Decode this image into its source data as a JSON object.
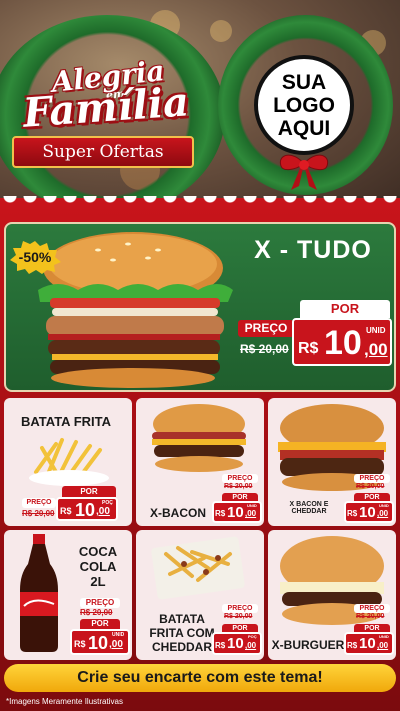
{
  "header": {
    "brand_line1": "Alegria",
    "brand_em": "em",
    "brand_line2": "Família",
    "subtitle": "Super Ofertas",
    "logo_placeholder": [
      "SUA",
      "LOGO",
      "AQUI"
    ]
  },
  "featured": {
    "name": "X - TUDO",
    "discount_badge": "-50%",
    "por_label": "POR",
    "preco_label": "PREÇO",
    "old_price": "R$ 20,00",
    "currency": "R$",
    "price_int": "10",
    "price_cents": ",00",
    "unit": "UNID"
  },
  "products": [
    {
      "name": "BATATA FRITA",
      "preco_label": "PREÇO",
      "old_price": "R$ 20,00",
      "por_label": "POR",
      "currency": "R$",
      "price_int": "10",
      "price_cents": ",00",
      "unit": "POÇ"
    },
    {
      "name": "X-BACON",
      "preco_label": "PREÇO",
      "old_price": "R$ 20,00",
      "por_label": "POR",
      "currency": "R$",
      "price_int": "10",
      "price_cents": ",00",
      "unit": "UNID"
    },
    {
      "name": "X BACON E CHEDDAR",
      "preco_label": "PREÇO",
      "old_price": "R$ 20,00",
      "por_label": "POR",
      "currency": "R$",
      "price_int": "10",
      "price_cents": ",00",
      "unit": "UNID"
    },
    {
      "name": "COCA COLA 2L",
      "preco_label": "PREÇO",
      "old_price": "R$ 20,00",
      "por_label": "POR",
      "currency": "R$",
      "price_int": "10",
      "price_cents": ",00",
      "unit": "UNID"
    },
    {
      "name": "BATATA FRITA COM CHEDDAR",
      "preco_label": "PREÇO",
      "old_price": "R$ 20,00",
      "por_label": "POR",
      "currency": "R$",
      "price_int": "10",
      "price_cents": ",00",
      "unit": "POÇ"
    },
    {
      "name": "X-BURGUER",
      "preco_label": "PREÇO",
      "old_price": "R$ 20,00",
      "por_label": "POR",
      "currency": "R$",
      "price_int": "10",
      "price_cents": ",00",
      "unit": "UNID"
    }
  ],
  "footer": {
    "cta": "Crie seu encarte com este tema!",
    "disclaimer": "*Imagens Meramente Ilustrativas"
  },
  "colors": {
    "accent_red": "#c8141c",
    "green": "#2c7a3d",
    "gold": "#f2c04b"
  }
}
